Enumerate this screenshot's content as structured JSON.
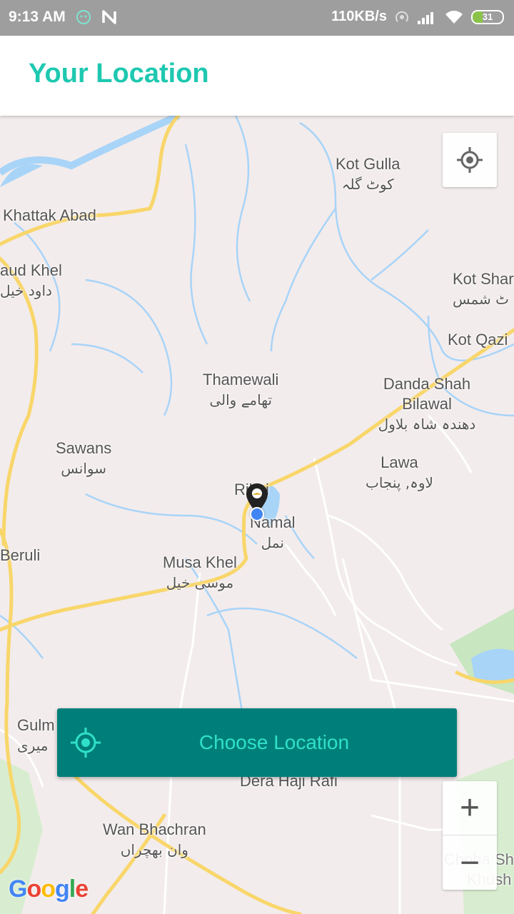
{
  "status_bar": {
    "time": "9:13 AM",
    "network_speed": "110KB/s",
    "battery": "31",
    "icons": [
      "lion-icon",
      "n-icon",
      "hotspot-icon",
      "signal-icon",
      "wifi-icon",
      "battery-icon"
    ]
  },
  "app_bar": {
    "title": "Your Location"
  },
  "map": {
    "places": [
      {
        "name": "Kot Gulla",
        "sub": "کوٹ گلہ"
      },
      {
        "name": "Khattak Abad",
        "sub": ""
      },
      {
        "name": "aud Khel",
        "sub": "داود خیل"
      },
      {
        "name": "Kot Shar",
        "sub": "ٹ شمس"
      },
      {
        "name": "Kot Qazi",
        "sub": ""
      },
      {
        "name": "Thamewali",
        "sub": "تھامے والی"
      },
      {
        "name": "Danda Shah Bilawal",
        "sub": "دھندہ شاہ بلاول"
      },
      {
        "name": "Sawans",
        "sub": "سوانس"
      },
      {
        "name": "Lawa",
        "sub": "لاوہ, پنجاب"
      },
      {
        "name": "Rikhi",
        "sub": ""
      },
      {
        "name": "Namal",
        "sub": "نمل"
      },
      {
        "name": "Beruli",
        "sub": ""
      },
      {
        "name": "Musa Khel",
        "sub": "موسی خیل"
      },
      {
        "name": "Gulm",
        "sub": "میری"
      },
      {
        "name": "Dera Haji Rafi",
        "sub": ""
      },
      {
        "name": "Wan Bhachran",
        "sub": "وان بھچراں"
      },
      {
        "name": "Choha Sh",
        "sub": "Khush"
      }
    ]
  },
  "choose_location": {
    "label": "Choose Location",
    "icon": "crosshair-icon"
  },
  "zoom": {
    "in_label": "+",
    "out_label": "−"
  },
  "google_logo": "Google",
  "colors": {
    "accent": "#1ec8b0",
    "button_bg": "#007f7a",
    "button_text": "#30e0c8",
    "dot": "#4285f4"
  }
}
